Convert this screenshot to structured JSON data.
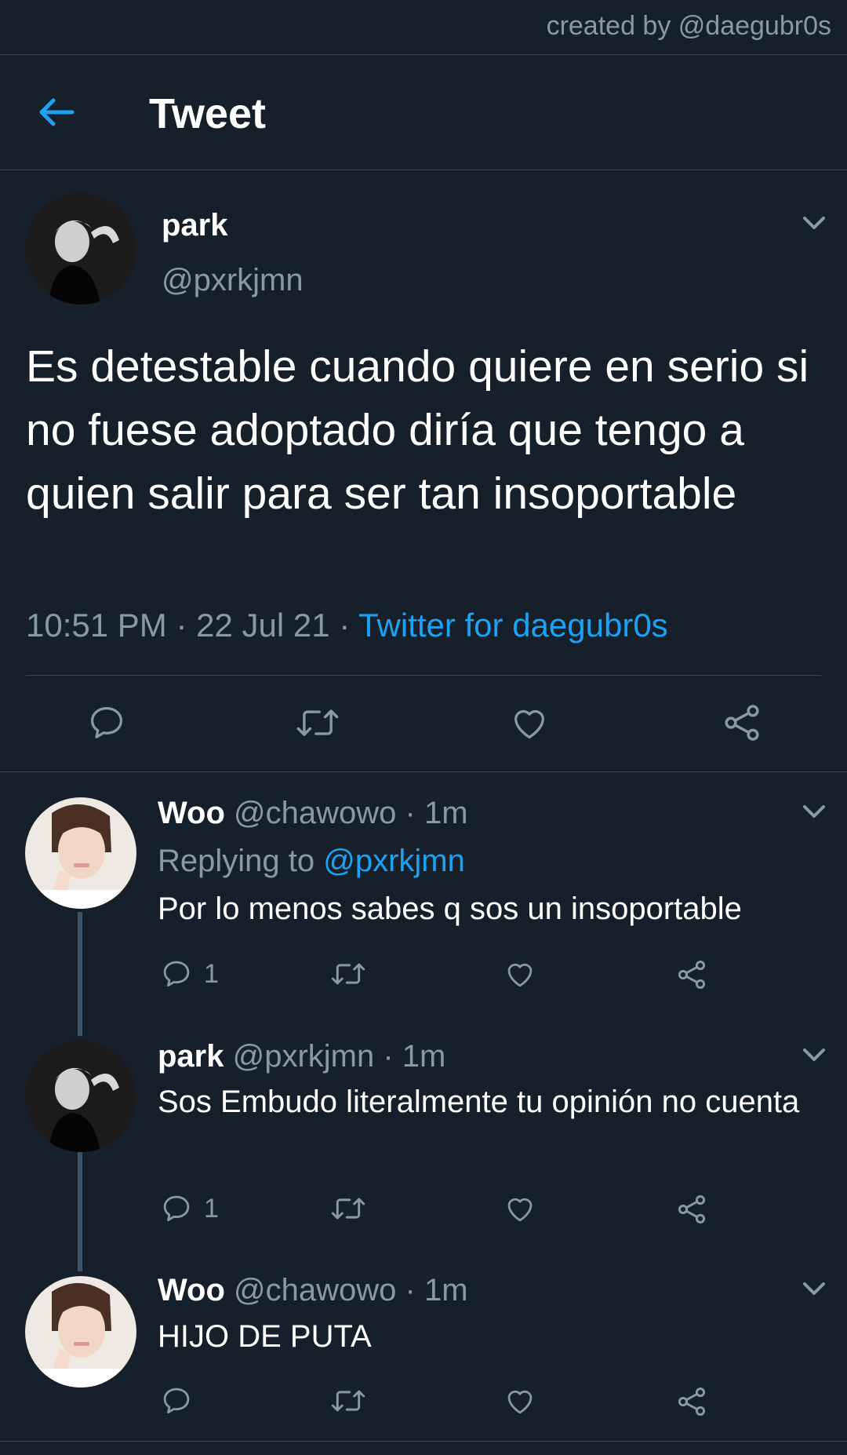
{
  "watermark": "created by @daegubr0s",
  "header": {
    "title": "Tweet"
  },
  "main_tweet": {
    "name": "park",
    "handle": "@pxrkjmn",
    "text": "Es detestable cuando quiere en serio si no fuese adoptado diría que tengo a quien salir para ser tan insoportable",
    "time": "10:51 PM",
    "date": "22 Jul 21",
    "separator": " · ",
    "source": "Twitter for daegubr0s"
  },
  "replies": [
    {
      "name": "Woo",
      "handle": "@chawowo",
      "dot": " · ",
      "time": "1m",
      "replying_prefix": "Replying to ",
      "replying_to": "@pxrkjmn",
      "text": "Por lo menos sabes q sos un insoportable",
      "reply_count": "1"
    },
    {
      "name": "park",
      "handle": "@pxrkjmn",
      "dot": " · ",
      "time": "1m",
      "text": "Sos Embudo literalmente tu opinión no cuenta",
      "reply_count": "1"
    },
    {
      "name": "Woo",
      "handle": "@chawowo",
      "dot": " · ",
      "time": "1m",
      "text": "HIJO DE PUTA",
      "reply_count": ""
    }
  ],
  "colors": {
    "background": "#15202b",
    "accent": "#1da1f2",
    "secondary_text": "#8899a6",
    "divider": "#38444d"
  },
  "icons": [
    "back-arrow-icon",
    "chevron-down-icon",
    "reply-icon",
    "retweet-icon",
    "like-icon",
    "share-icon"
  ]
}
